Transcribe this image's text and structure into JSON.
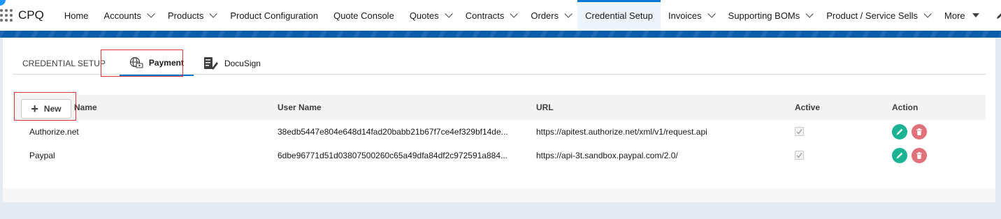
{
  "nav": {
    "app_name": "CPQ",
    "items": [
      {
        "label": "Home",
        "dropdown": false
      },
      {
        "label": "Accounts",
        "dropdown": true
      },
      {
        "label": "Products",
        "dropdown": true
      },
      {
        "label": "Product Configuration",
        "dropdown": false
      },
      {
        "label": "Quote Console",
        "dropdown": false
      },
      {
        "label": "Quotes",
        "dropdown": true
      },
      {
        "label": "Contracts",
        "dropdown": true
      },
      {
        "label": "Orders",
        "dropdown": true
      },
      {
        "label": "Credential Setup",
        "dropdown": false,
        "active": true
      },
      {
        "label": "Invoices",
        "dropdown": true
      },
      {
        "label": "Supporting BOMs",
        "dropdown": true
      },
      {
        "label": "Product / Service Sells",
        "dropdown": true
      }
    ],
    "more_label": "More"
  },
  "tabs": {
    "credential_setup": "CREDENTIAL SETUP",
    "payment": "Payment",
    "docusign": "DocuSign"
  },
  "table": {
    "new_button": "New",
    "headers": {
      "name": "Name",
      "user_name": "User Name",
      "url": "URL",
      "active": "Active",
      "action": "Action"
    },
    "rows": [
      {
        "name": "Authorize.net",
        "user_name": "38edb5447e804e648d14fad20babb21b67f7ce4ef329bf14de...",
        "url": "https://apitest.authorize.net/xml/v1/request.api",
        "active": true
      },
      {
        "name": "Paypal",
        "user_name": "6dbe96771d51d03807500260c65a49dfa84df2c972591a884...",
        "url": "https://api-3t.sandbox.paypal.com/2.0/",
        "active": true
      }
    ]
  },
  "colors": {
    "accent": "#0176d3",
    "edit": "#1ab394",
    "delete": "#e0707a",
    "highlight": "#dd3333"
  }
}
